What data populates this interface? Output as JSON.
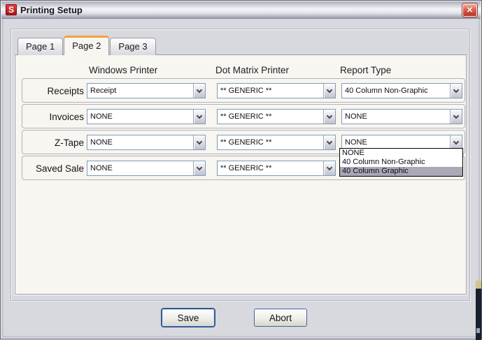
{
  "window": {
    "title": "Printing Setup",
    "icon_letter": "S",
    "close_glyph": "×"
  },
  "tabs": [
    {
      "label": "Page 1",
      "active": false
    },
    {
      "label": "Page 2",
      "active": true
    },
    {
      "label": "Page 3",
      "active": false
    }
  ],
  "table": {
    "headers": [
      "Windows Printer",
      "Dot Matrix Printer",
      "Report Type"
    ],
    "rows": [
      {
        "label": "Receipts",
        "windows_printer": "Receipt",
        "dot_matrix_printer": "** GENERIC **",
        "report_type": "40 Column Non-Graphic"
      },
      {
        "label": "Invoices",
        "windows_printer": "NONE",
        "dot_matrix_printer": "** GENERIC **",
        "report_type": "NONE"
      },
      {
        "label": "Z-Tape",
        "windows_printer": "NONE",
        "dot_matrix_printer": "** GENERIC **",
        "report_type": "NONE"
      },
      {
        "label": "Saved Sale",
        "windows_printer": "NONE",
        "dot_matrix_printer": "** GENERIC **"
      }
    ]
  },
  "open_dropdown": {
    "for": "z-tape-report-type",
    "options": [
      "NONE",
      "40 Column Non-Graphic",
      "40 Column Graphic"
    ],
    "highlighted_index": 2
  },
  "buttons": {
    "save": "Save",
    "abort": "Abort"
  },
  "colors": {
    "active_tab_accent": "#f0a23c",
    "close_button_red": "#c23a28",
    "dropdown_highlight": "#a9a9b7",
    "combo_border": "#7f9db9"
  }
}
